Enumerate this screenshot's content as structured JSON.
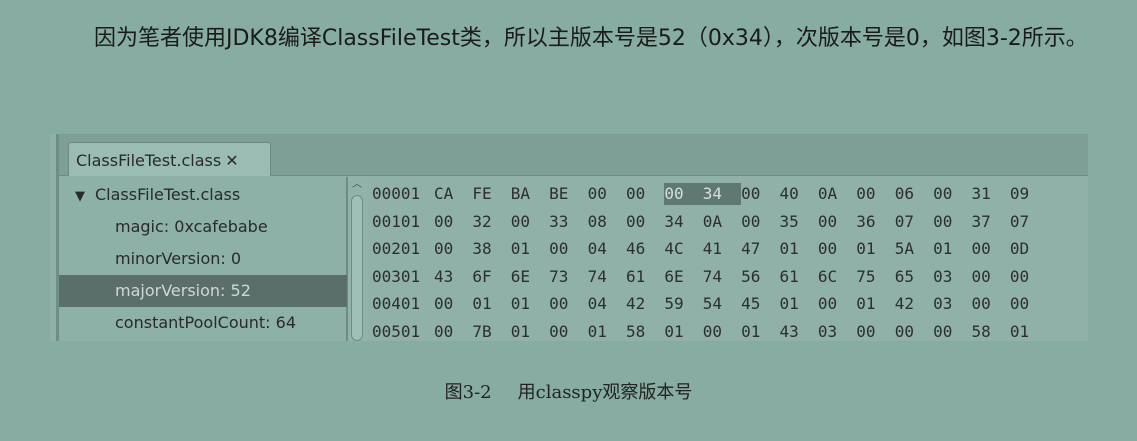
{
  "paragraph": "因为笔者使用JDK8编译ClassFileTest类，所以主版本号是52（0x34），次版本号是0，如图3-2所示。",
  "screenshot": {
    "tab_label": "ClassFileTest.class",
    "tab_close": "✕",
    "tree": {
      "root_arrow": "▼",
      "root": "ClassFileTest.class",
      "items": [
        "magic: 0xcafebabe",
        "minorVersion: 0",
        "majorVersion: 52",
        "constantPoolCount: 64"
      ],
      "selected_index": 2
    },
    "scroll_up": "︿",
    "hex": {
      "rows": [
        {
          "offset": "00001",
          "bytes": [
            "CA",
            "FE",
            "BA",
            "BE",
            "00",
            "00",
            "00",
            "34",
            "00",
            "40",
            "0A",
            "00",
            "06",
            "00",
            "31",
            "09"
          ]
        },
        {
          "offset": "00101",
          "bytes": [
            "00",
            "32",
            "00",
            "33",
            "08",
            "00",
            "34",
            "0A",
            "00",
            "35",
            "00",
            "36",
            "07",
            "00",
            "37",
            "07"
          ]
        },
        {
          "offset": "00201",
          "bytes": [
            "00",
            "38",
            "01",
            "00",
            "04",
            "46",
            "4C",
            "41",
            "47",
            "01",
            "00",
            "01",
            "5A",
            "01",
            "00",
            "0D"
          ]
        },
        {
          "offset": "00301",
          "bytes": [
            "43",
            "6F",
            "6E",
            "73",
            "74",
            "61",
            "6E",
            "74",
            "56",
            "61",
            "6C",
            "75",
            "65",
            "03",
            "00",
            "00"
          ]
        },
        {
          "offset": "00401",
          "bytes": [
            "00",
            "01",
            "01",
            "00",
            "04",
            "42",
            "59",
            "54",
            "45",
            "01",
            "00",
            "01",
            "42",
            "03",
            "00",
            "00"
          ]
        },
        {
          "offset": "00501",
          "bytes": [
            "00",
            "7B",
            "01",
            "00",
            "01",
            "58",
            "01",
            "00",
            "01",
            "43",
            "03",
            "00",
            "00",
            "00",
            "58",
            "01"
          ]
        }
      ],
      "highlight": {
        "row": 0,
        "from": 6,
        "to": 7
      }
    }
  },
  "caption": {
    "number": "图3-2",
    "text": "用classpy观察版本号"
  }
}
